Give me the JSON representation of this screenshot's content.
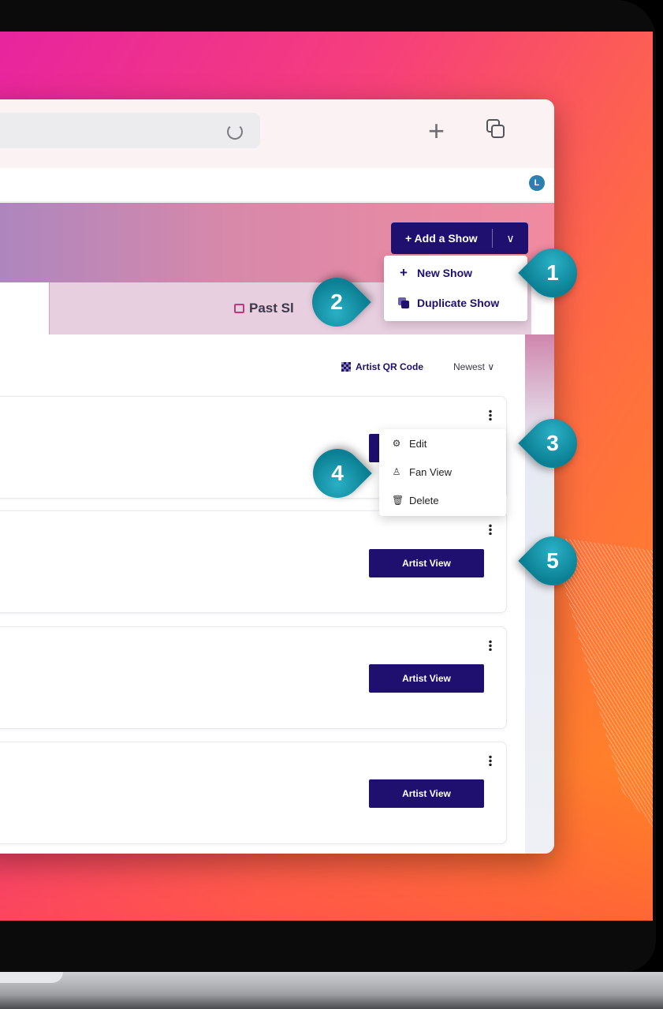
{
  "add_show": {
    "button_label": "+ Add a Show",
    "chevron": "∨",
    "menu": [
      {
        "label": "New Show",
        "icon": "plus-icon"
      },
      {
        "label": "Duplicate Show",
        "icon": "duplicate-icon"
      }
    ]
  },
  "avatar_initial": "L",
  "tabs": {
    "past_label": "Past Sl"
  },
  "filters": {
    "qr_label": "Artist QR Code",
    "sort_label": "Newest ∨"
  },
  "show_menu": [
    {
      "label": "Edit",
      "icon": "gear-icon"
    },
    {
      "label": "Fan View",
      "icon": "user-icon"
    },
    {
      "label": "Delete",
      "icon": "trash-icon"
    }
  ],
  "cards": [
    {
      "button": ""
    },
    {
      "button": "Artist View"
    },
    {
      "button": "Artist View"
    },
    {
      "button": "Artist View"
    }
  ],
  "callouts": [
    "1",
    "2",
    "3",
    "4",
    "5"
  ],
  "colors": {
    "primary": "#1f0f6e",
    "callout": "#1a97ab"
  }
}
